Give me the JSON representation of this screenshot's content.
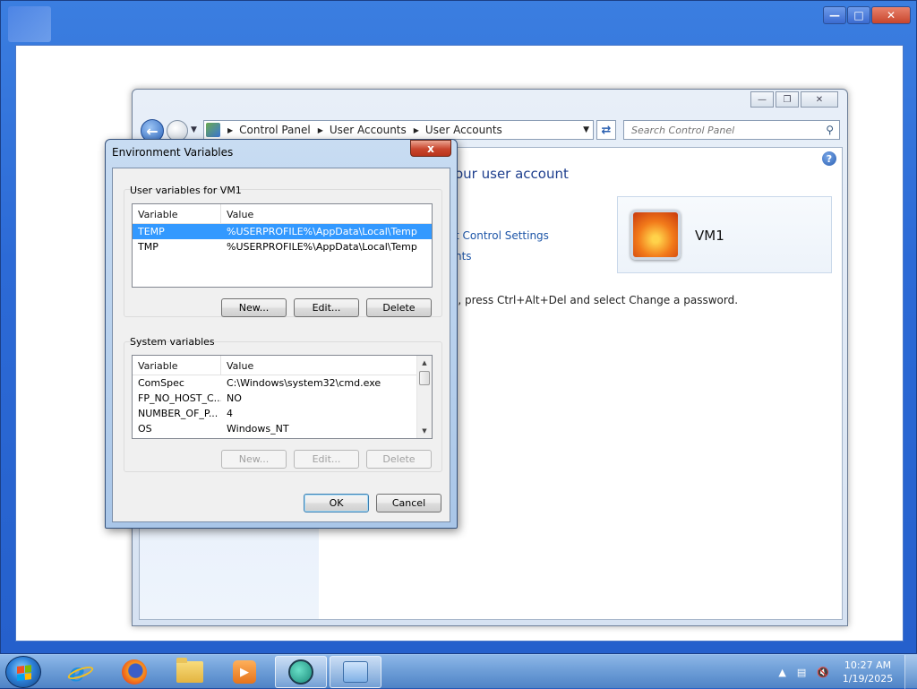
{
  "outer_window": {
    "minimize_icon": "minimize-icon",
    "maximize_icon": "maximize-icon",
    "close_icon": "close-icon"
  },
  "control_panel": {
    "breadcrumb": [
      "Control Panel",
      "User Accounts",
      "User Accounts"
    ],
    "search_placeholder": "Search Control Panel",
    "heading_fragment": "our user account",
    "link_uac": "t Control Settings",
    "link_other": "nts",
    "password_text": "l, press Ctrl+Alt+Del and select Change a password.",
    "user_name": "VM1"
  },
  "dialog": {
    "title": "Environment Variables",
    "close_label": "x",
    "user_group_label": "User variables for VM1",
    "system_group_label": "System variables",
    "col_variable": "Variable",
    "col_value": "Value",
    "user_vars": [
      {
        "name": "TEMP",
        "value": "%USERPROFILE%\\AppData\\Local\\Temp",
        "selected": true
      },
      {
        "name": "TMP",
        "value": "%USERPROFILE%\\AppData\\Local\\Temp",
        "selected": false
      }
    ],
    "system_vars": [
      {
        "name": "ComSpec",
        "value": "C:\\Windows\\system32\\cmd.exe"
      },
      {
        "name": "FP_NO_HOST_C...",
        "value": "NO"
      },
      {
        "name": "NUMBER_OF_P...",
        "value": "4"
      },
      {
        "name": "OS",
        "value": "Windows_NT"
      }
    ],
    "user_buttons": {
      "new": "New...",
      "edit": "Edit...",
      "delete": "Delete"
    },
    "system_buttons": {
      "new": "New...",
      "edit": "Edit...",
      "delete": "Delete"
    },
    "ok": "OK",
    "cancel": "Cancel"
  },
  "taskbar": {
    "pinned": [
      "internet-explorer",
      "firefox",
      "windows-explorer",
      "media-player",
      "app",
      "control-panel"
    ],
    "clock_time": "10:27 AM",
    "clock_date": "1/19/2025"
  },
  "colors": {
    "selection": "#3399ff",
    "link": "#1e56a8",
    "heading": "#1e3f8e"
  }
}
